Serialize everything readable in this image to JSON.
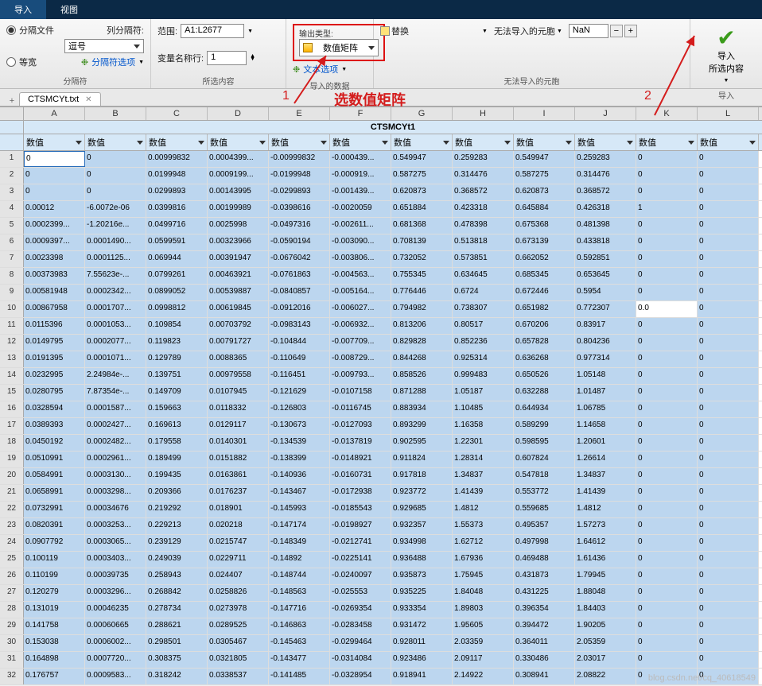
{
  "ribbon": {
    "tabs": [
      "导入",
      "视图"
    ],
    "active": 0
  },
  "sec1": {
    "opt1": "分隔文件",
    "opt2": "等宽",
    "col_sep_lbl": "列分隔符:",
    "col_sep_val": "逗号",
    "opts_link": "分隔符选项",
    "label": "分隔符"
  },
  "sec2": {
    "range_lbl": "范围:",
    "range_val": "A1:L2677",
    "varrow_lbl": "变量名称行:",
    "varrow_val": "1",
    "label": "所选内容"
  },
  "sec3": {
    "out_lbl": "输出类型:",
    "out_val": "数值矩阵",
    "text_opt": "文本选项",
    "label": "导入的数据"
  },
  "sec4": {
    "replace": "替换",
    "nocell_lbl": "无法导入的元胞",
    "nan": "NaN",
    "label": "无法导入的元胞"
  },
  "sec5": {
    "btn1": "导入",
    "btn2": "所选内容",
    "label": "导入"
  },
  "anno": {
    "n1": "1",
    "txt": "选数值矩阵",
    "n2": "2"
  },
  "file": {
    "name": "CTSMCYt.txt"
  },
  "grid": {
    "cols": [
      "A",
      "B",
      "C",
      "D",
      "E",
      "F",
      "G",
      "H",
      "I",
      "J",
      "K",
      "L"
    ],
    "title": "CTSMCYt1",
    "type_label": "数值",
    "rows": [
      [
        "0",
        "0",
        "0.00999832",
        "0.0004399...",
        "-0.00999832",
        "-0.000439...",
        "0.549947",
        "0.259283",
        "0.549947",
        "0.259283",
        "0",
        "0"
      ],
      [
        "0",
        "0",
        "0.0199948",
        "0.0009199...",
        "-0.0199948",
        "-0.000919...",
        "0.587275",
        "0.314476",
        "0.587275",
        "0.314476",
        "0",
        "0"
      ],
      [
        "0",
        "0",
        "0.0299893",
        "0.00143995",
        "-0.0299893",
        "-0.001439...",
        "0.620873",
        "0.368572",
        "0.620873",
        "0.368572",
        "0",
        "0"
      ],
      [
        "0.00012",
        "-6.0072e-06",
        "0.0399816",
        "0.00199989",
        "-0.0398616",
        "-0.0020059",
        "0.651884",
        "0.423318",
        "0.645884",
        "0.426318",
        "1",
        "0"
      ],
      [
        "0.0002399...",
        "-1.20216e...",
        "0.0499716",
        "0.0025998",
        "-0.0497316",
        "-0.002611...",
        "0.681368",
        "0.478398",
        "0.675368",
        "0.481398",
        "0",
        "0"
      ],
      [
        "0.0009397...",
        "0.0001490...",
        "0.0599591",
        "0.00323966",
        "-0.0590194",
        "-0.003090...",
        "0.708139",
        "0.513818",
        "0.673139",
        "0.433818",
        "0",
        "0"
      ],
      [
        "0.0023398",
        "0.0001125...",
        "0.069944",
        "0.00391947",
        "-0.0676042",
        "-0.003806...",
        "0.732052",
        "0.573851",
        "0.662052",
        "0.592851",
        "0",
        "0"
      ],
      [
        "0.00373983",
        "7.55623e-...",
        "0.0799261",
        "0.00463921",
        "-0.0761863",
        "-0.004563...",
        "0.755345",
        "0.634645",
        "0.685345",
        "0.653645",
        "0",
        "0"
      ],
      [
        "0.00581948",
        "0.0002342...",
        "0.0899052",
        "0.00539887",
        "-0.0840857",
        "-0.005164...",
        "0.776446",
        "0.6724",
        "0.672446",
        "0.5954",
        "0",
        "0"
      ],
      [
        "0.00867958",
        "0.0001707...",
        "0.0998812",
        "0.00619845",
        "-0.0912016",
        "-0.006027...",
        "0.794982",
        "0.738307",
        "0.651982",
        "0.772307",
        "0.0",
        "0"
      ],
      [
        "0.0115396",
        "0.0001053...",
        "0.109854",
        "0.00703792",
        "-0.0983143",
        "-0.006932...",
        "0.813206",
        "0.80517",
        "0.670206",
        "0.83917",
        "0",
        "0"
      ],
      [
        "0.0149795",
        "0.0002077...",
        "0.119823",
        "0.00791727",
        "-0.104844",
        "-0.007709...",
        "0.829828",
        "0.852236",
        "0.657828",
        "0.804236",
        "0",
        "0"
      ],
      [
        "0.0191395",
        "0.0001071...",
        "0.129789",
        "0.0088365",
        "-0.110649",
        "-0.008729...",
        "0.844268",
        "0.925314",
        "0.636268",
        "0.977314",
        "0",
        "0"
      ],
      [
        "0.0232995",
        "2.24984e-...",
        "0.139751",
        "0.00979558",
        "-0.116451",
        "-0.009793...",
        "0.858526",
        "0.999483",
        "0.650526",
        "1.05148",
        "0",
        "0"
      ],
      [
        "0.0280795",
        "7.87354e-...",
        "0.149709",
        "0.0107945",
        "-0.121629",
        "-0.0107158",
        "0.871288",
        "1.05187",
        "0.632288",
        "1.01487",
        "0",
        "0"
      ],
      [
        "0.0328594",
        "0.0001587...",
        "0.159663",
        "0.0118332",
        "-0.126803",
        "-0.0116745",
        "0.883934",
        "1.10485",
        "0.644934",
        "1.06785",
        "0",
        "0"
      ],
      [
        "0.0389393",
        "0.0002427...",
        "0.169613",
        "0.0129117",
        "-0.130673",
        "-0.0127093",
        "0.893299",
        "1.16358",
        "0.589299",
        "1.14658",
        "0",
        "0"
      ],
      [
        "0.0450192",
        "0.0002482...",
        "0.179558",
        "0.0140301",
        "-0.134539",
        "-0.0137819",
        "0.902595",
        "1.22301",
        "0.598595",
        "1.20601",
        "0",
        "0"
      ],
      [
        "0.0510991",
        "0.0002961...",
        "0.189499",
        "0.0151882",
        "-0.138399",
        "-0.0148921",
        "0.911824",
        "1.28314",
        "0.607824",
        "1.26614",
        "0",
        "0"
      ],
      [
        "0.0584991",
        "0.0003130...",
        "0.199435",
        "0.0163861",
        "-0.140936",
        "-0.0160731",
        "0.917818",
        "1.34837",
        "0.547818",
        "1.34837",
        "0",
        "0"
      ],
      [
        "0.0658991",
        "0.0003298...",
        "0.209366",
        "0.0176237",
        "-0.143467",
        "-0.0172938",
        "0.923772",
        "1.41439",
        "0.553772",
        "1.41439",
        "0",
        "0"
      ],
      [
        "0.0732991",
        "0.00034676",
        "0.219292",
        "0.018901",
        "-0.145993",
        "-0.0185543",
        "0.929685",
        "1.4812",
        "0.559685",
        "1.4812",
        "0",
        "0"
      ],
      [
        "0.0820391",
        "0.0003253...",
        "0.229213",
        "0.020218",
        "-0.147174",
        "-0.0198927",
        "0.932357",
        "1.55373",
        "0.495357",
        "1.57273",
        "0",
        "0"
      ],
      [
        "0.0907792",
        "0.0003065...",
        "0.239129",
        "0.0215747",
        "-0.148349",
        "-0.0212741",
        "0.934998",
        "1.62712",
        "0.497998",
        "1.64612",
        "0",
        "0"
      ],
      [
        "0.100119",
        "0.0003403...",
        "0.249039",
        "0.0229711",
        "-0.14892",
        "-0.0225141",
        "0.936488",
        "1.67936",
        "0.469488",
        "1.61436",
        "0",
        "0"
      ],
      [
        "0.110199",
        "0.00039735",
        "0.258943",
        "0.024407",
        "-0.148744",
        "-0.0240097",
        "0.935873",
        "1.75945",
        "0.431873",
        "1.79945",
        "0",
        "0"
      ],
      [
        "0.120279",
        "0.0003296...",
        "0.268842",
        "0.0258826",
        "-0.148563",
        "-0.025553",
        "0.935225",
        "1.84048",
        "0.431225",
        "1.88048",
        "0",
        "0"
      ],
      [
        "0.131019",
        "0.00046235",
        "0.278734",
        "0.0273978",
        "-0.147716",
        "-0.0269354",
        "0.933354",
        "1.89803",
        "0.396354",
        "1.84403",
        "0",
        "0"
      ],
      [
        "0.141758",
        "0.00060665",
        "0.288621",
        "0.0289525",
        "-0.146863",
        "-0.0283458",
        "0.931472",
        "1.95605",
        "0.394472",
        "1.90205",
        "0",
        "0"
      ],
      [
        "0.153038",
        "0.0006002...",
        "0.298501",
        "0.0305467",
        "-0.145463",
        "-0.0299464",
        "0.928011",
        "2.03359",
        "0.364011",
        "2.05359",
        "0",
        "0"
      ],
      [
        "0.164898",
        "0.0007720...",
        "0.308375",
        "0.0321805",
        "-0.143477",
        "-0.0314084",
        "0.923486",
        "2.09117",
        "0.330486",
        "2.03017",
        "0",
        "0"
      ],
      [
        "0.176757",
        "0.0009583...",
        "0.318242",
        "0.0338537",
        "-0.141485",
        "-0.0328954",
        "0.918941",
        "2.14922",
        "0.308941",
        "2.08822",
        "0",
        "0"
      ]
    ]
  },
  "watermark": "blog.csdn.net/cq_40618549"
}
